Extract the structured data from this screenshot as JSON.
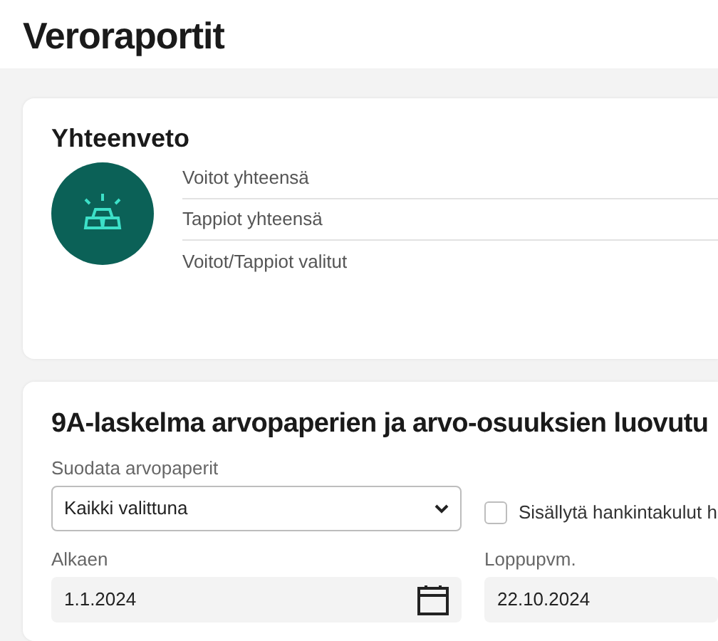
{
  "page_title": "Veroraportit",
  "summary": {
    "title": "Yhteenveto",
    "rows": [
      {
        "label": "Voitot yhteensä"
      },
      {
        "label": "Tappiot yhteensä"
      },
      {
        "label": "Voitot/Tappiot valitut"
      }
    ]
  },
  "report": {
    "title": "9A-laskelma arvopaperien ja arvo-osuuksien luovutu",
    "filter": {
      "label": "Suodata arvopaperit",
      "value": "Kaikki valittuna"
    },
    "include_costs": {
      "label": "Sisällytä hankintakulut h",
      "checked": false
    },
    "start_date": {
      "label": "Alkaen",
      "value": "1.1.2024"
    },
    "end_date": {
      "label": "Loppupvm.",
      "value": "22.10.2024"
    }
  }
}
